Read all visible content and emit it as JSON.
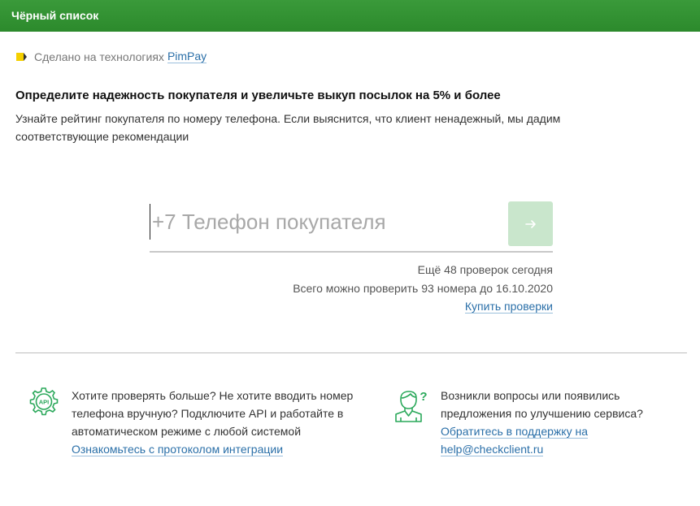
{
  "header": {
    "title": "Чёрный список"
  },
  "tech": {
    "prefix": "Сделано на технологиях",
    "link": "PimPay"
  },
  "intro": {
    "title": "Определите надежность покупателя и увеличьте выкуп посылок на 5% и более",
    "description": "Узнайте рейтинг покупателя по номеру телефона. Если выяснится, что клиент ненадежный, мы дадим соответствующие рекомендации"
  },
  "phone": {
    "placeholder": "+7 Телефон покупателя",
    "value": ""
  },
  "limits": {
    "today": "Ещё 48 проверок сегодня",
    "total": "Всего можно проверить 93 номера до 16.10.2020",
    "buy_link": "Купить проверки"
  },
  "api_block": {
    "icon": "api-gear-icon",
    "text": "Хотите проверять больше? Не хотите вводить номер телефона вручную? Подключите API и работайте в автоматическом режиме с любой системой",
    "link": "Ознакомьтесь с протоколом интеграции"
  },
  "support_block": {
    "icon": "support-person-icon",
    "text": "Возникли вопросы или появились предложения по улучшению сервиса?",
    "link_line1": "Обратитесь в поддержку на",
    "link_line2": "help@checkclient.ru"
  },
  "colors": {
    "header": "#2c8a2c",
    "link": "#2a6fa8",
    "button_disabled": "#c9e6cc",
    "icon_green": "#2aa85a"
  }
}
